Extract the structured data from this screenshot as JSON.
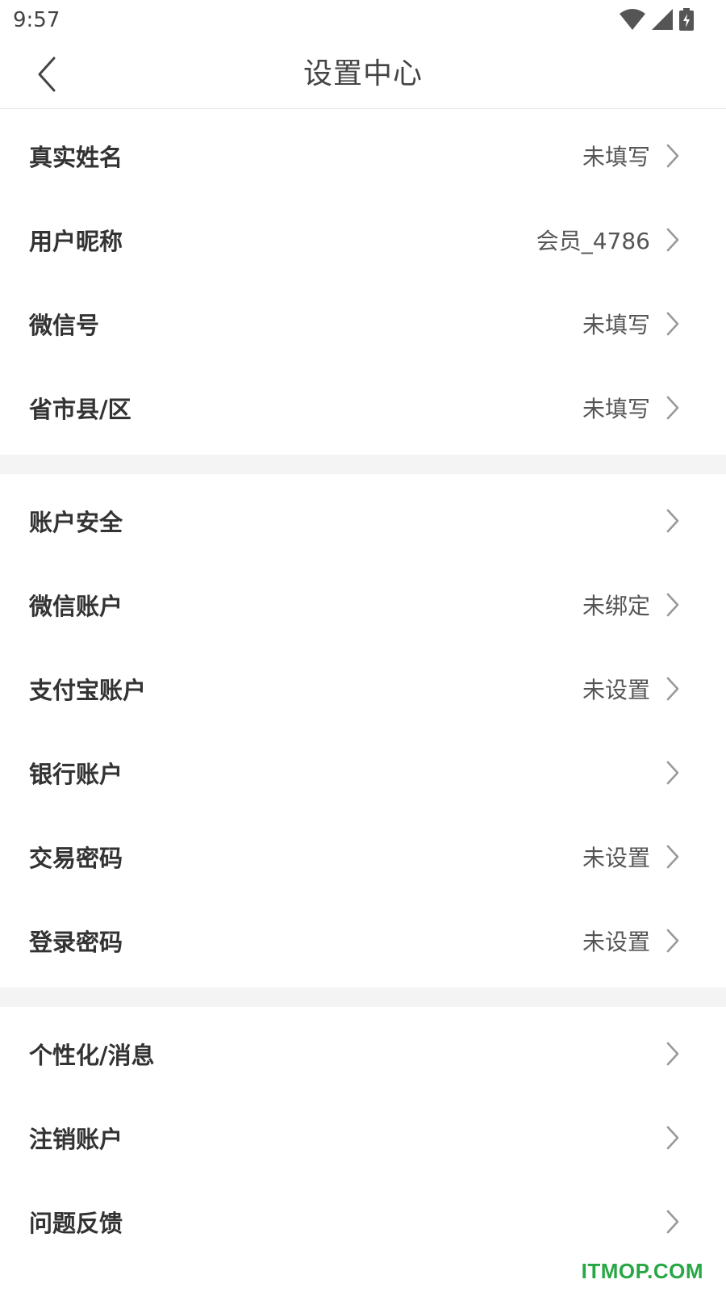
{
  "status_bar": {
    "time": "9:57"
  },
  "header": {
    "title": "设置中心"
  },
  "groups": [
    {
      "rows": [
        {
          "label": "真实姓名",
          "value": "未填写"
        },
        {
          "label": "用户昵称",
          "value": "会员_4786"
        },
        {
          "label": "微信号",
          "value": "未填写"
        },
        {
          "label": "省市县/区",
          "value": "未填写"
        }
      ]
    },
    {
      "rows": [
        {
          "label": "账户安全",
          "value": ""
        },
        {
          "label": "微信账户",
          "value": "未绑定"
        },
        {
          "label": "支付宝账户",
          "value": "未设置"
        },
        {
          "label": "银行账户",
          "value": ""
        },
        {
          "label": "交易密码",
          "value": "未设置"
        },
        {
          "label": "登录密码",
          "value": "未设置"
        }
      ]
    },
    {
      "rows": [
        {
          "label": "个性化/消息",
          "value": ""
        },
        {
          "label": "注销账户",
          "value": ""
        },
        {
          "label": "问题反馈",
          "value": ""
        }
      ]
    }
  ],
  "watermark": "ITMOP.COM",
  "icons": {
    "back": "back-arrow-icon",
    "chevron": "chevron-right-icon",
    "wifi": "wifi-icon",
    "signal": "signal-icon",
    "battery": "battery-charging-icon"
  },
  "colors": {
    "text_primary": "#333333",
    "text_secondary": "#555555",
    "chevron": "#999999",
    "divider_band": "#f4f4f4",
    "watermark": "#28a745"
  }
}
